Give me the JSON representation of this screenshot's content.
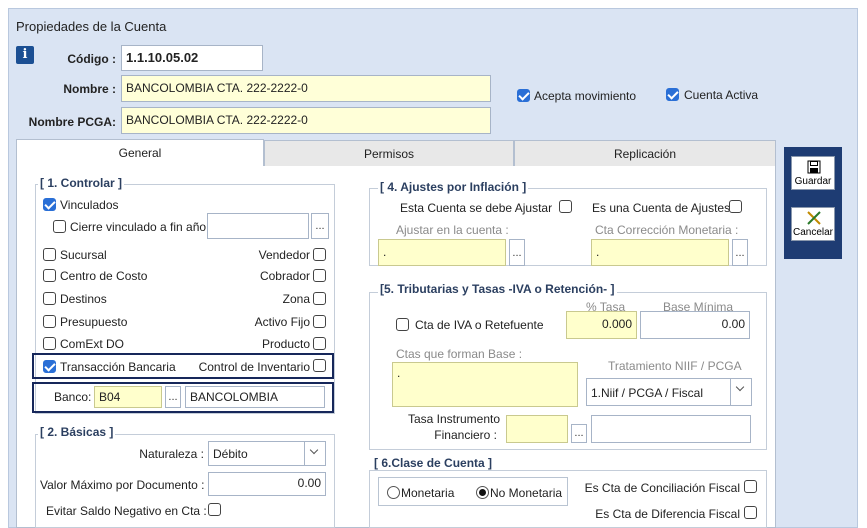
{
  "window": {
    "title": "Propiedades de la Cuenta"
  },
  "header": {
    "codigo_label": "Código :",
    "codigo_value": "1.1.10.05.02",
    "nombre_label": "Nombre :",
    "nombre_value": "BANCOLOMBIA CTA. 222-2222-0",
    "nombre_pcga_label": "Nombre PCGA:",
    "nombre_pcga_value": "BANCOLOMBIA CTA. 222-2222-0",
    "acepta_movimiento": "Acepta movimiento",
    "cuenta_activa": "Cuenta Activa"
  },
  "tabs": [
    {
      "label": "General"
    },
    {
      "label": "Permisos"
    },
    {
      "label": "Replicación"
    }
  ],
  "actions": {
    "guardar": "Guardar",
    "cancelar": "Cancelar"
  },
  "controlar": {
    "title": "[ 1. Controlar ]",
    "vinculados": "Vinculados",
    "cierre": "Cierre vinculado a fin año",
    "sucursal": "Sucursal",
    "vendedor": "Vendedor",
    "centro_costo": "Centro de Costo",
    "cobrador": "Cobrador",
    "destinos": "Destinos",
    "zona": "Zona",
    "presupuesto": "Presupuesto",
    "activo_fijo": "Activo Fijo",
    "comext": "ComExt DO",
    "producto": "Producto",
    "transaccion": "Transacción Bancaria",
    "control_inventario": "Control de Inventario",
    "banco_label": "Banco:",
    "banco_code": "B04",
    "banco_name": "BANCOLOMBIA"
  },
  "basicas": {
    "title": "[ 2. Básicas ]",
    "naturaleza_label": "Naturaleza :",
    "naturaleza_value": "Débito",
    "valor_max_label": "Valor Máximo por Documento :",
    "valor_max_value": "0.00",
    "evitar_label": "Evitar Saldo Negativo en Cta :"
  },
  "ajustes": {
    "title": "[ 4. Ajustes por Inflación ]",
    "se_debe_ajustar": "Esta Cuenta  se debe Ajustar",
    "es_cuenta_ajustes": "Es una Cuenta de Ajustes",
    "ajustar_en": "Ajustar en la cuenta :",
    "cta_correccion": "Cta Corrección Monetaria :",
    "dot": "."
  },
  "tributarias": {
    "title": "[5. Tributarias y Tasas  -IVA o Retención- ]",
    "tasa_header": "% Tasa",
    "base_header": "Base Mínima",
    "cta_iva": "Cta de IVA o Retefuente",
    "tasa_value": "0.000",
    "base_value": "0.00",
    "ctas_base": "Ctas que forman Base :",
    "tratamiento_label": "Tratamiento NIIF / PCGA",
    "tratamiento_value": "1.Niif / PCGA / Fiscal",
    "tasa_instrumento": "Tasa Instrumento",
    "financiero": "Financiero :",
    "dot": "."
  },
  "clase": {
    "title": "[ 6.Clase de Cuenta ]",
    "monetaria": "Monetaria",
    "no_monetaria": "No Monetaria",
    "conciliacion": "Es Cta de Conciliación Fiscal",
    "diferencia": "Es Cta de Diferencia Fiscal"
  }
}
